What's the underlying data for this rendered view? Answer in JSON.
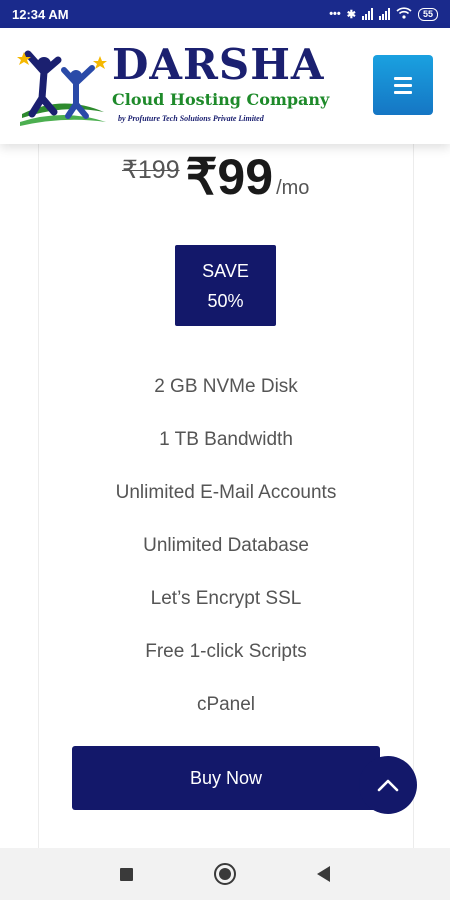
{
  "status_bar": {
    "time": "12:34 AM",
    "battery": "55",
    "icons": [
      "dots-icon",
      "bluetooth-icon",
      "volte-icon",
      "signal-icon",
      "volte-icon",
      "signal-icon",
      "wifi-icon",
      "battery-icon"
    ]
  },
  "header": {
    "brand_name": "DARSHA",
    "brand_tagline": "Cloud Hosting Company",
    "brand_subline": "by Profuture Tech Solutions Private Limited",
    "menu_icon": "hamburger-icon"
  },
  "plan": {
    "old_price": "₹199",
    "price": "₹99",
    "period": "/mo",
    "save_line1": "SAVE",
    "save_line2": "50%",
    "features": [
      "2 GB NVMe Disk",
      "1 TB Bandwidth",
      "Unlimited E-Mail Accounts",
      "Unlimited Database",
      "Let’s Encrypt SSL",
      "Free 1-click Scripts",
      "cPanel"
    ],
    "buy_label": "Buy Now"
  },
  "colors": {
    "status_bar": "#1a2a8c",
    "brand_navy": "#13186a",
    "brand_green": "#1e8a2a",
    "menu_blue": "#1576c4"
  },
  "nav": {
    "icons": [
      "recent-apps-icon",
      "home-icon",
      "back-icon"
    ]
  }
}
